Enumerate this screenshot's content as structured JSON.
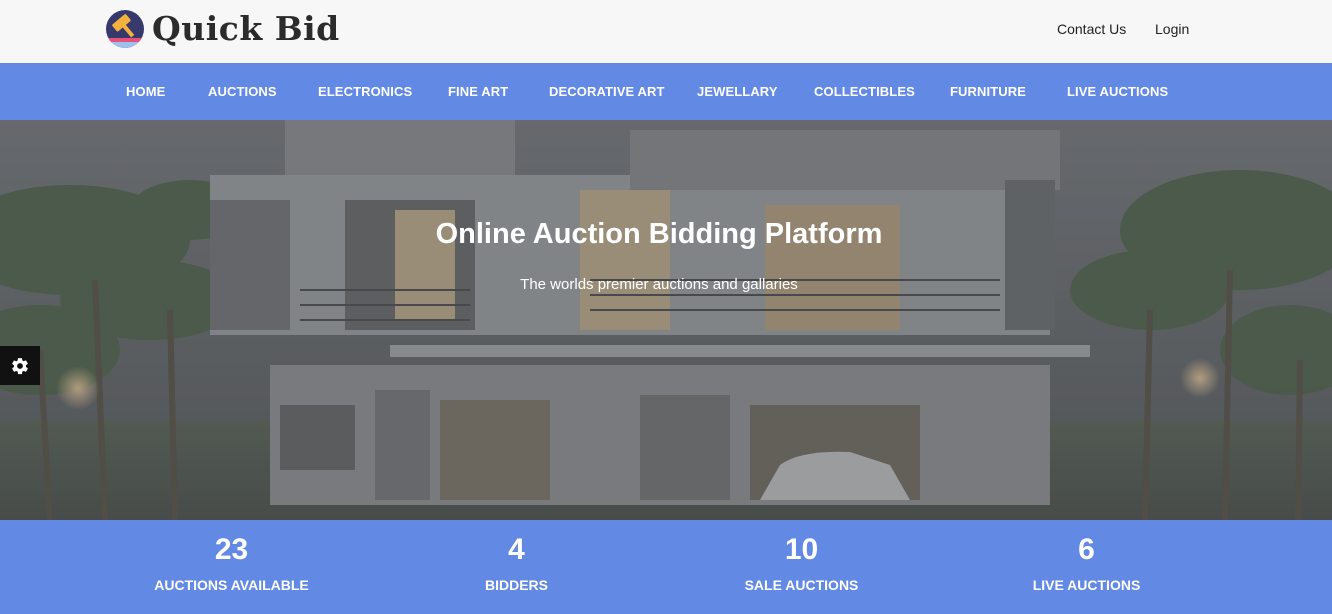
{
  "brand": {
    "name": "Quick Bid",
    "logo_icon": "gavel-icon",
    "colors": {
      "primary": "#6289e3",
      "topbar": "#f7f7f7",
      "logo_circle": "#37386b",
      "gavel": "#f4b23c",
      "stripe": "#e5527a"
    }
  },
  "topbar": {
    "links": [
      {
        "label": "Contact Us"
      },
      {
        "label": "Login"
      }
    ]
  },
  "nav": {
    "items": [
      {
        "label": "HOME"
      },
      {
        "label": "AUCTIONS"
      },
      {
        "label": "ELECTRONICS"
      },
      {
        "label": "FINE ART"
      },
      {
        "label": "DECORATIVE ART"
      },
      {
        "label": "JEWELLARY"
      },
      {
        "label": "COLLECTIBLES"
      },
      {
        "label": "FURNITURE"
      },
      {
        "label": "LIVE AUCTIONS"
      }
    ]
  },
  "hero": {
    "title": "Online Auction Bidding Platform",
    "subtitle": "The worlds premier auctions and gallaries",
    "background_icon": "modern-house-photo",
    "settings_icon": "gear-icon"
  },
  "stats": [
    {
      "value": "23",
      "label": "AUCTIONS AVAILABLE"
    },
    {
      "value": "4",
      "label": "BIDDERS"
    },
    {
      "value": "10",
      "label": "SALE AUCTIONS"
    },
    {
      "value": "6",
      "label": "LIVE AUCTIONS"
    }
  ]
}
